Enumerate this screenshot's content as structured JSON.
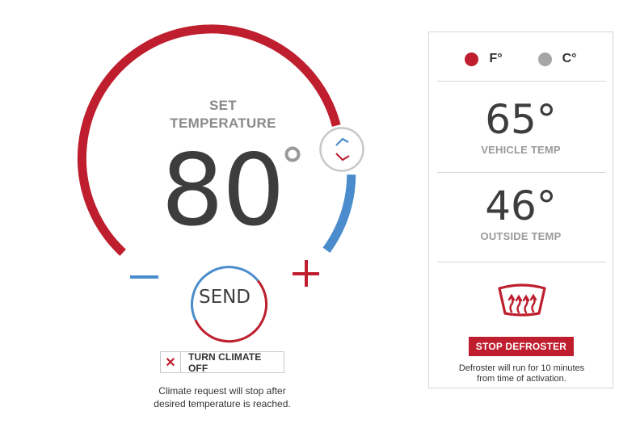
{
  "dial": {
    "set_label_line1": "SET",
    "set_label_line2": "TEMPERATURE",
    "temperature": "80",
    "degree_icon": "degree-ring-icon",
    "send_label": "SEND",
    "handle_icon": "drag-handle-chevron-icon",
    "minus_icon": "minus-icon",
    "plus_icon": "plus-icon",
    "colors": {
      "warm": "#be1e2d",
      "cool": "#4a8ccc",
      "handle": "#c8c8c8"
    }
  },
  "climate_off": {
    "icon": "close-icon",
    "x_glyph": "✕",
    "label": "TURN CLIMATE OFF"
  },
  "climate_note_line1": "Climate request will stop after",
  "climate_note_line2": "desired temperature is reached.",
  "panel": {
    "units": [
      {
        "label": "F°",
        "selected": true,
        "color": "#be1e2d"
      },
      {
        "label": "C°",
        "selected": false,
        "color": "#a6a6a6"
      }
    ],
    "vehicle_temp": {
      "value": "65°",
      "label": "VEHICLE TEMP"
    },
    "outside_temp": {
      "value": "46°",
      "label": "OUTSIDE TEMP"
    },
    "defroster_icon": "rear-defroster-icon",
    "stop_defroster_label": "STOP DEFROSTER",
    "defroster_note_line1": "Defroster will run for 10 minutes",
    "defroster_note_line2": "from time of activation."
  }
}
